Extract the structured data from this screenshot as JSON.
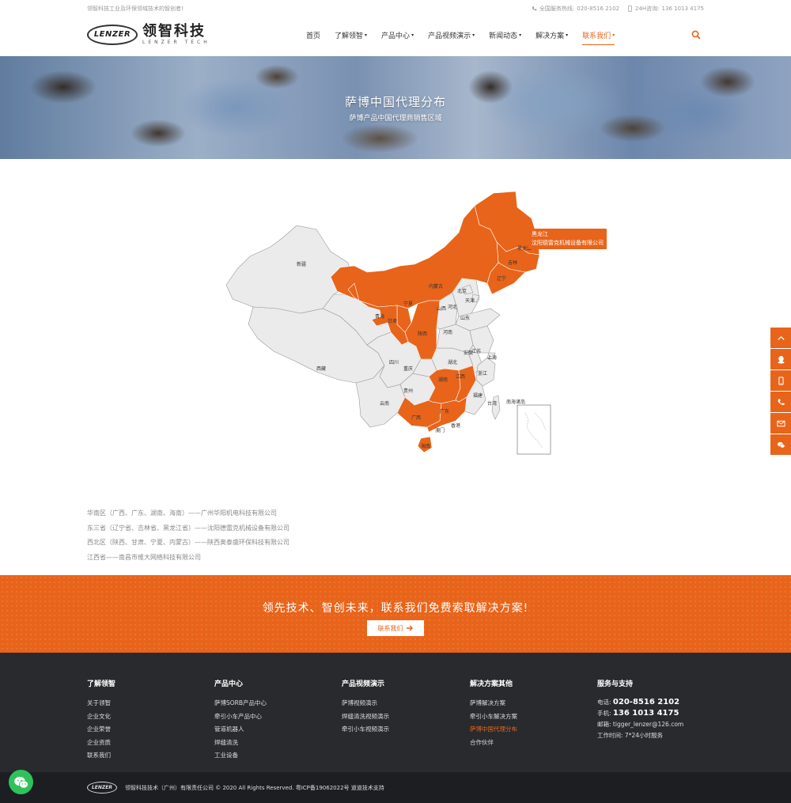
{
  "topbar": {
    "slogan": "领智科技工业及环保领域技术的智创者!",
    "hotline_label": "全国服务热线:",
    "hotline": "020-8516 2102",
    "consult_label": "24H咨询:",
    "consult": "136 1013 4175"
  },
  "logo": {
    "mark": "LENZER",
    "cn": "领智科技",
    "en": "LENZER TECH"
  },
  "nav": [
    {
      "label": "首页",
      "caret": false
    },
    {
      "label": "了解领智",
      "caret": true
    },
    {
      "label": "产品中心",
      "caret": true
    },
    {
      "label": "产品视频演示",
      "caret": true
    },
    {
      "label": "新闻动态",
      "caret": true
    },
    {
      "label": "解决方案",
      "caret": true
    },
    {
      "label": "联系我们",
      "caret": true,
      "active": true
    }
  ],
  "banner": {
    "title": "萨博中国代理分布",
    "subtitle": "萨博产品中国代理商销售区域"
  },
  "map": {
    "highlight_color": "#e8641a",
    "tooltip_title": "黑龙江",
    "tooltip_body": "沈阳德雷克机械设备有限公司",
    "labels": {
      "xinjiang": "新疆",
      "xizang": "西藏",
      "qinghai": "青海",
      "gansu": "甘肃",
      "neimenggu": "内蒙古",
      "ningxia": "宁夏",
      "shaanxi": "陕西",
      "sichuan": "四川",
      "chongqing": "重庆",
      "yunnan": "云南",
      "guizhou": "贵州",
      "guangxi": "广西",
      "guangdong": "广东",
      "hunan": "湖南",
      "hubei": "湖北",
      "jiangxi": "江西",
      "henan": "河南",
      "shanxi": "山西",
      "hebei": "河北",
      "beijing": "北京",
      "tianjin": "天津",
      "shandong": "山东",
      "jiangsu": "江苏",
      "anhui": "安徽",
      "shanghai": "上海",
      "zhejiang": "浙江",
      "fujian": "福建",
      "taiwan": "台湾",
      "heilongjiang": "黑龙江",
      "jilin": "吉林",
      "liaoning": "辽宁",
      "hainan": "海南",
      "aomen": "澳门",
      "xianggang": "香港",
      "nanhai": "南海诸岛"
    }
  },
  "distributors": [
    "华南区（广西、广东、湖南、海南）——广州华阳机电科技有限公司",
    "东三省（辽宁省、吉林省、黑龙江省）——沈阳德雷克机械设备有限公司",
    "西北区（陕西、甘肃、宁夏、内蒙古）——陕西奥泰盛环保科技有限公司",
    "江西省——南昌市维大网络科技有限公司"
  ],
  "cta": {
    "title": "领先技术、智创未来，联系我们免费索取解决方案!",
    "button": "联系我们"
  },
  "footer": {
    "cols": [
      {
        "title": "了解领智",
        "links": [
          "关于领智",
          "企业文化",
          "企业荣誉",
          "企业资质",
          "联系我们"
        ]
      },
      {
        "title": "产品中心",
        "links": [
          "萨博SORB产品中心",
          "牵引小车产品中心",
          "管道机器人",
          "焊缝清洗",
          "工业设备"
        ]
      },
      {
        "title": "产品视频演示",
        "links": [
          "萨博视频演示",
          "焊缝清洗视频演示",
          "牵引小车视频演示"
        ]
      },
      {
        "title": "解决方案其他",
        "links": [
          "萨博解决方案",
          "牵引小车解决方案",
          "萨博中国代理分布",
          "合作伙伴"
        ]
      }
    ],
    "service": {
      "title": "服务与支持",
      "tel_label": "电话:",
      "tel": "020-8516 2102",
      "mobile_label": "手机:",
      "mobile": "136 1013 4175",
      "email_label": "邮箱:",
      "email": "tigger_lenzer@126.com",
      "hours_label": "工作时间:",
      "hours": "7*24小时服务"
    }
  },
  "bottom": {
    "logo": "LENZER",
    "copyright": "领智科技技术（广州）有限责任公司 © 2020 All Rights Reserved. 粤ICP备19062022号    道道技术支持"
  },
  "colors": {
    "accent": "#e8641a",
    "footer_bg": "#292a2e",
    "bottom_bg": "#1d1e21",
    "wechat": "#2fc25b"
  },
  "side_icons": [
    "chevron-up-icon",
    "qq-icon",
    "mobile-icon",
    "phone-icon",
    "mail-icon",
    "wechat-icon"
  ]
}
